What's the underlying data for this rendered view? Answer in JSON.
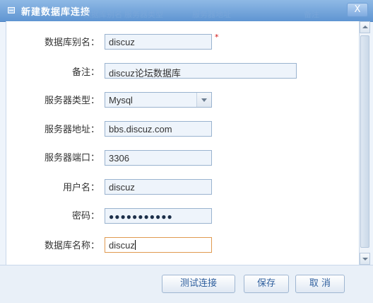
{
  "dialog": {
    "title": "新建数据库连接",
    "close_label": "X",
    "ghost_headers": [
      "数据库别名",
      "服务器类型",
      "服务器地址",
      "备注"
    ]
  },
  "fields": {
    "alias": {
      "label": "数据库别名：",
      "value": "discuz",
      "required_mark": "*"
    },
    "note": {
      "label": "备注：",
      "value": "discuz论坛数据库"
    },
    "server_type": {
      "label": "服务器类型：",
      "value": "Mysql"
    },
    "server_address": {
      "label": "服务器地址：",
      "value": "bbs.discuz.com"
    },
    "server_port": {
      "label": "服务器端口：",
      "value": "3306"
    },
    "username": {
      "label": "用户名：",
      "value": "discuz"
    },
    "password": {
      "label": "密码：",
      "value": "●●●●●●●●●●●"
    },
    "db_name": {
      "label": "数据库名称：",
      "value": "discuz"
    }
  },
  "buttons": {
    "test": "测试连接",
    "save": "保存",
    "cancel": "取 消"
  },
  "colors": {
    "title_bar": "#5f95d2",
    "focus_border": "#e09a50",
    "required": "#d01010"
  }
}
